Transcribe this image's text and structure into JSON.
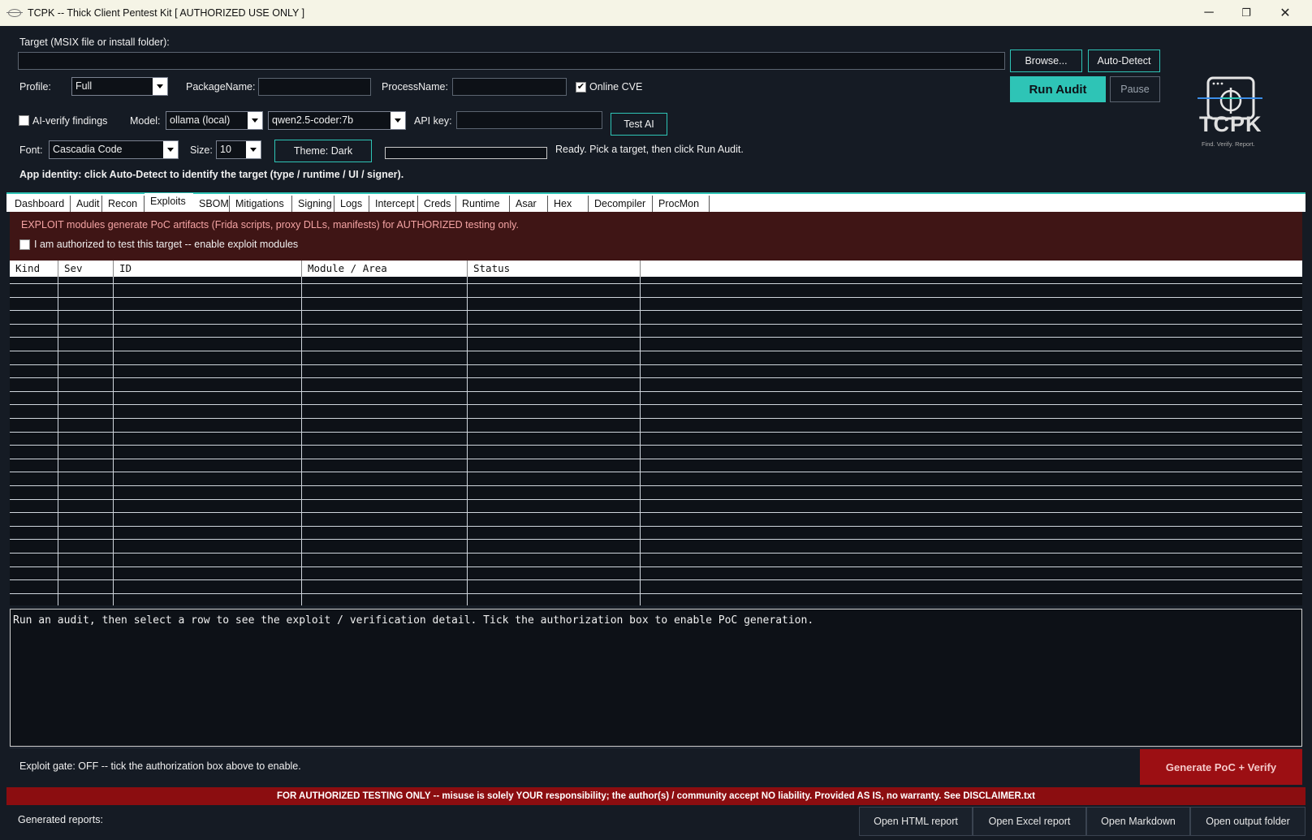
{
  "window": {
    "title": "TCPK -- Thick Client Pentest Kit   [ AUTHORIZED USE ONLY ]",
    "minimize": "─",
    "restore": "❐",
    "close": "✕"
  },
  "target": {
    "label": "Target (MSIX file or install folder):",
    "value": "",
    "browse_label": "Browse...",
    "autodetect_label": "Auto-Detect"
  },
  "profile": {
    "label": "Profile:",
    "value": "Full",
    "package_label": "PackageName:",
    "package_value": "",
    "process_label": "ProcessName:",
    "process_value": "",
    "online_cve_label": "Online CVE",
    "online_cve_checked": true
  },
  "actions": {
    "run_label": "Run Audit",
    "pause_label": "Pause"
  },
  "ai": {
    "verify_label": "AI-verify findings",
    "verify_checked": false,
    "model_label": "Model:",
    "model_value": "ollama (local)",
    "model_name": "qwen2.5-coder:7b",
    "apikey_label": "API key:",
    "apikey_value": "",
    "test_label": "Test AI"
  },
  "appearance": {
    "font_label": "Font:",
    "font_value": "Cascadia Code",
    "size_label": "Size:",
    "size_value": "10",
    "theme_label": "Theme: Dark",
    "progress": 0,
    "status_text": "Ready. Pick a target, then click Run Audit."
  },
  "identity_text": "App identity: click Auto-Detect to identify the target (type / runtime / UI / signer).",
  "logo": {
    "name": "TCPK",
    "tagline": "Find. Verify. Report."
  },
  "tabs": [
    "Dashboard",
    "Audit",
    "Recon",
    "Exploits",
    "SBOM",
    "Mitigations",
    "Signing",
    "Logs",
    "Intercept",
    "Creds",
    "Runtime",
    "Asar",
    "Hex",
    "Decompiler",
    "ProcMon"
  ],
  "active_tab": "Exploits",
  "exploits": {
    "warning": "EXPLOIT modules generate PoC artifacts (Frida scripts, proxy DLLs, manifests) for AUTHORIZED testing only.",
    "authorize_label": "I am authorized to test this target -- enable exploit modules",
    "authorize_checked": false,
    "columns": [
      "Kind",
      "Sev",
      "ID",
      "Module / Area",
      "Status"
    ],
    "rows": [],
    "detail_text": "Run an audit, then select a row to see the exploit / verification detail. Tick the authorization box to enable PoC generation.",
    "gate_text": "Exploit gate: OFF  --  tick the authorization box above to enable.",
    "generate_label": "Generate PoC + Verify"
  },
  "disclaimer": "FOR AUTHORIZED TESTING ONLY  --  misuse is solely YOUR responsibility; the author(s) / community accept NO liability.  Provided AS IS, no warranty.  See DISCLAIMER.txt",
  "reports": {
    "label": "Generated reports:",
    "html": "Open HTML report",
    "excel": "Open Excel report",
    "markdown": "Open Markdown",
    "folder": "Open output folder"
  },
  "colors": {
    "accent": "#2ec4b6",
    "background": "#151b24",
    "danger": "#9c0f13",
    "warning_panel": "#3f1515"
  }
}
